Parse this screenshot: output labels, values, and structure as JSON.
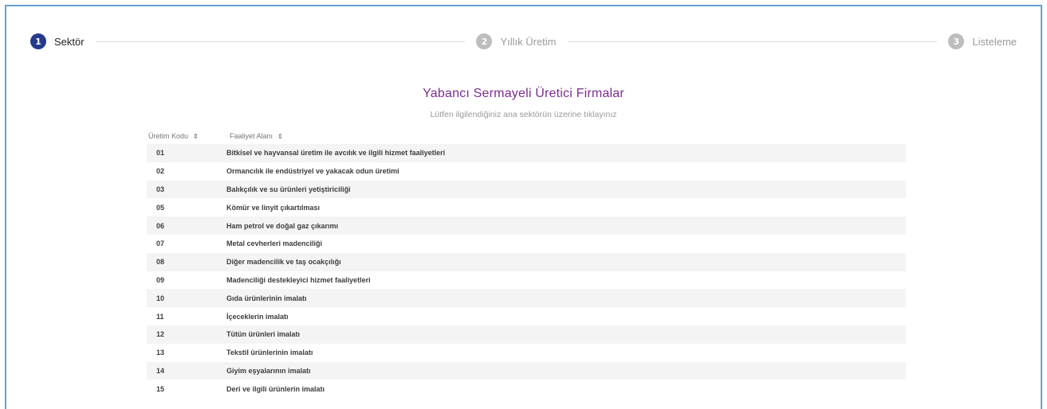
{
  "stepper": {
    "steps": [
      {
        "number": "1",
        "label": "Sektör",
        "active": true
      },
      {
        "number": "2",
        "label": "Yıllık Üretim",
        "active": false
      },
      {
        "number": "3",
        "label": "Listeleme",
        "active": false
      }
    ]
  },
  "page": {
    "title": "Yabancı Sermayeli Üretici Firmalar",
    "subtitle": "Lütfen ilgilendiğiniz ana sektörün üzerine tıklayınız"
  },
  "table": {
    "columns": {
      "code": "Üretim Kodu",
      "desc": "Faaliyet Alanı"
    },
    "rows": [
      {
        "code": "01",
        "desc": "Bitkisel ve hayvansal üretim ile avcılık ve ilgili hizmet faaliyetleri"
      },
      {
        "code": "02",
        "desc": "Ormancılık ile endüstriyel ve yakacak odun üretimi"
      },
      {
        "code": "03",
        "desc": "Balıkçılık ve su ürünleri yetiştiriciliği"
      },
      {
        "code": "05",
        "desc": "Kömür ve linyit çıkartılması"
      },
      {
        "code": "06",
        "desc": "Ham petrol ve doğal gaz çıkarımı"
      },
      {
        "code": "07",
        "desc": "Metal cevherleri madenciliği"
      },
      {
        "code": "08",
        "desc": "Diğer madencilik ve taş ocakçılığı"
      },
      {
        "code": "09",
        "desc": "Madenciliği destekleyici hizmet faaliyetleri"
      },
      {
        "code": "10",
        "desc": "Gıda ürünlerinin imalatı"
      },
      {
        "code": "11",
        "desc": "İçeceklerin imalatı"
      },
      {
        "code": "12",
        "desc": "Tütün ürünleri imalatı"
      },
      {
        "code": "13",
        "desc": "Tekstil ürünlerinin imalatı"
      },
      {
        "code": "14",
        "desc": "Giyim eşyalarının imalatı"
      },
      {
        "code": "15",
        "desc": "Deri ve ilgili ürünlerin imalatı"
      }
    ]
  },
  "colors": {
    "accent": "#243a8c",
    "title": "#7b2d8e",
    "frame": "#6a9fd6"
  }
}
